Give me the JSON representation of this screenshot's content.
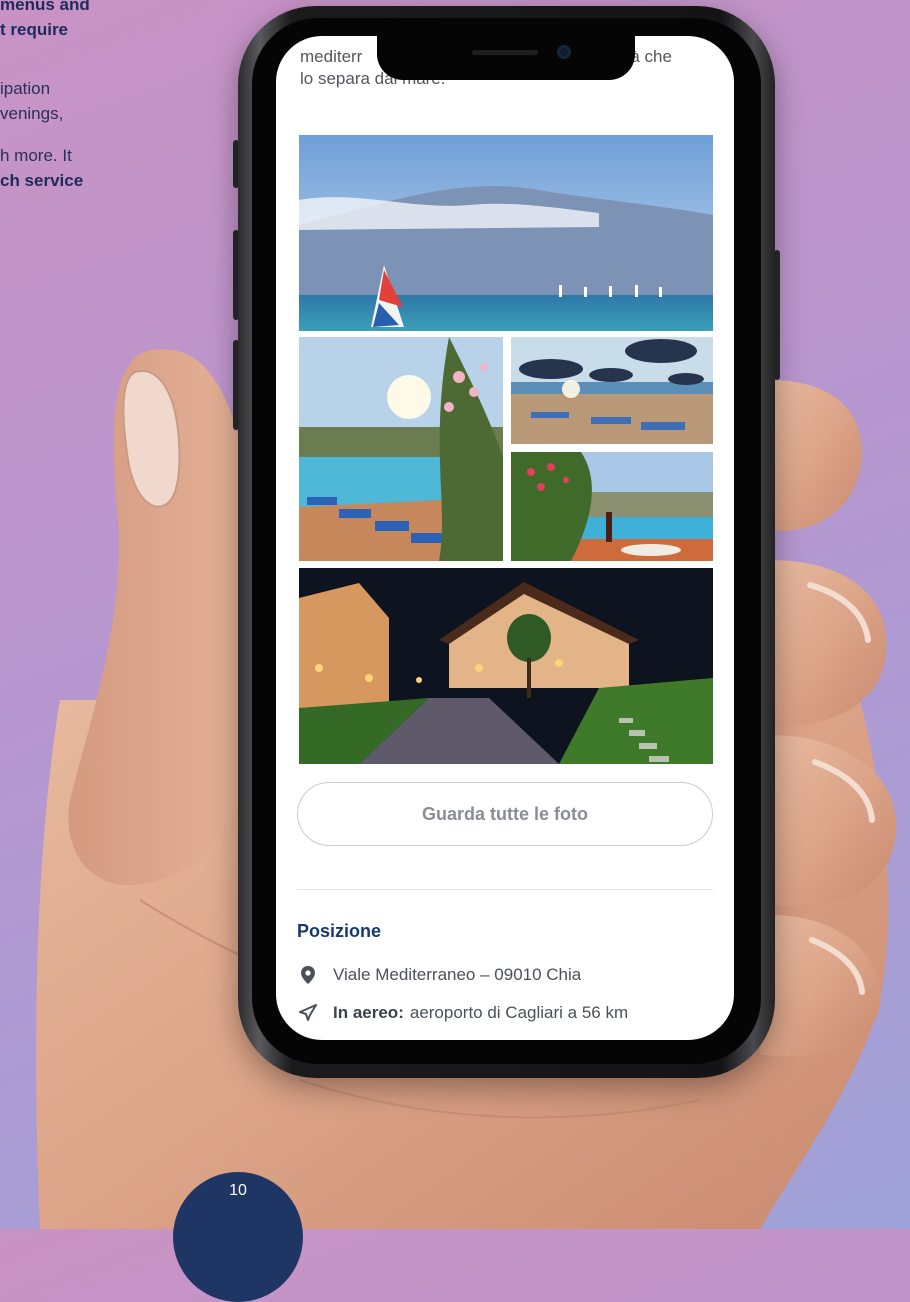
{
  "promo": {
    "lines": [
      {
        "text": "menus and",
        "bold": true
      },
      {
        "text": "t require",
        "bold": true
      },
      {
        "text": "ipation",
        "bold": false
      },
      {
        "text": "venings,",
        "bold": false
      },
      {
        "text": "h more. It",
        "bold": false
      },
      {
        "text": "ch service",
        "bold": true
      }
    ]
  },
  "screen": {
    "intro_line_1_start": "mediterr",
    "intro_line_1_end": "ietà che",
    "intro_line_2": "lo separa dal mare.",
    "gallery": {
      "photos": [
        "beach-windsurf",
        "pool-oleander",
        "beach-umbrellas",
        "pool-dining",
        "village-night"
      ]
    },
    "all_photos_button": "Guarda tutte le foto",
    "location": {
      "title": "Posizione",
      "address": "Viale Mediterraneo – 09010 Chia",
      "air_label": "In aereo:",
      "air_value": "aeroporto di Cagliari a 56 km"
    }
  },
  "page": {
    "number": "10"
  },
  "colors": {
    "background_start": "#c993c4",
    "background_end": "#9fa2d8",
    "heading_blue": "#163a6e",
    "badge_navy": "#1f3564"
  }
}
